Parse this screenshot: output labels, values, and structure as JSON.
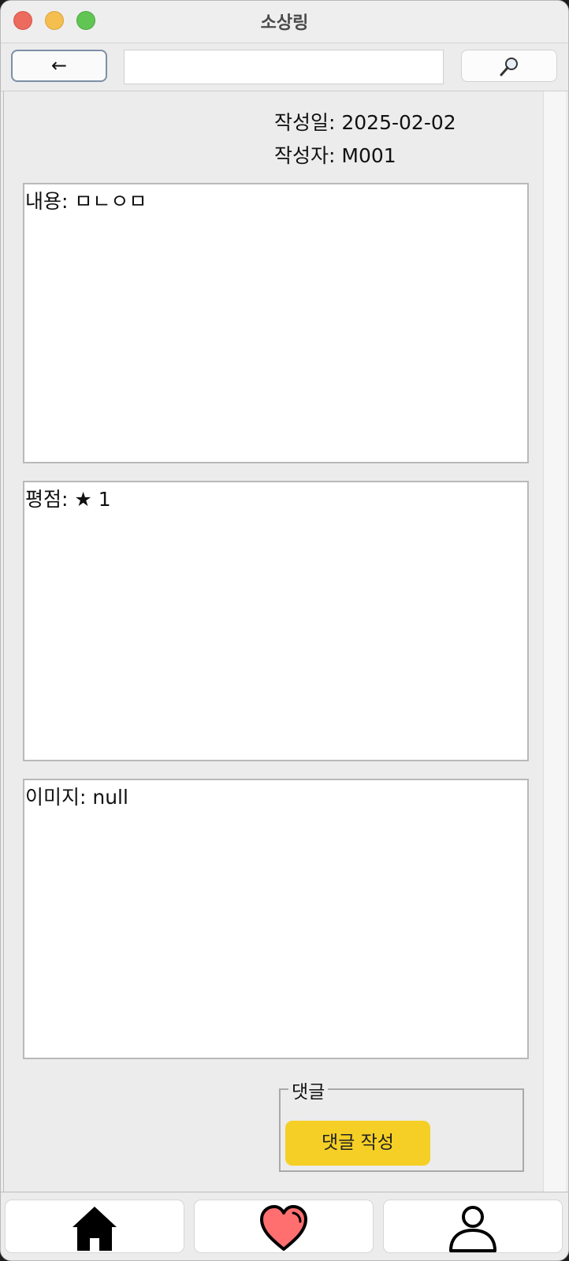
{
  "window": {
    "title": "소상링"
  },
  "toolbar": {
    "back_label": "←",
    "search_value": "",
    "search_icon": "magnifier-icon"
  },
  "post": {
    "date_text": "작성일: 2025-02-02",
    "author_text": "작성자: M001",
    "content_text": "내용: ㅁㄴㅇㅁ",
    "rating_text": "평점: ★ 1",
    "image_text": "이미지: null"
  },
  "comments": {
    "legend": "댓글",
    "write_button_label": "댓글 작성"
  },
  "bottom_nav": {
    "items": [
      {
        "icon": "home-icon"
      },
      {
        "icon": "heart-icon"
      },
      {
        "icon": "user-icon"
      }
    ]
  },
  "colors": {
    "accent_button": "#f5cf25",
    "heart": "#ff6f6f"
  }
}
